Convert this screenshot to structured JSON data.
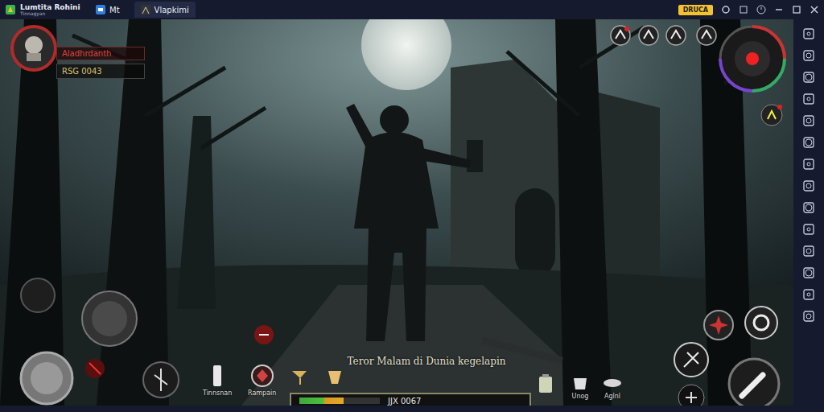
{
  "window": {
    "title": "Lumtita Rohini",
    "subtitle": "Tinnagyan",
    "tabs": [
      {
        "label": "Mt",
        "selected": false
      },
      {
        "label": "Vlapkimi",
        "selected": true
      }
    ],
    "badge": "DRUCA"
  },
  "player": {
    "name": "Aladhrdanth",
    "stat": "RSG 0043"
  },
  "game_title": "Teror Malam di Dunia kegelapin",
  "health": {
    "reading": "JJX 0067",
    "level": 0.55
  },
  "hotbar": [
    {
      "label": "Tinnsnan"
    },
    {
      "label": "Rampain"
    }
  ],
  "inventory": [
    {
      "label": "Unog"
    },
    {
      "label": "Aglnl"
    }
  ]
}
